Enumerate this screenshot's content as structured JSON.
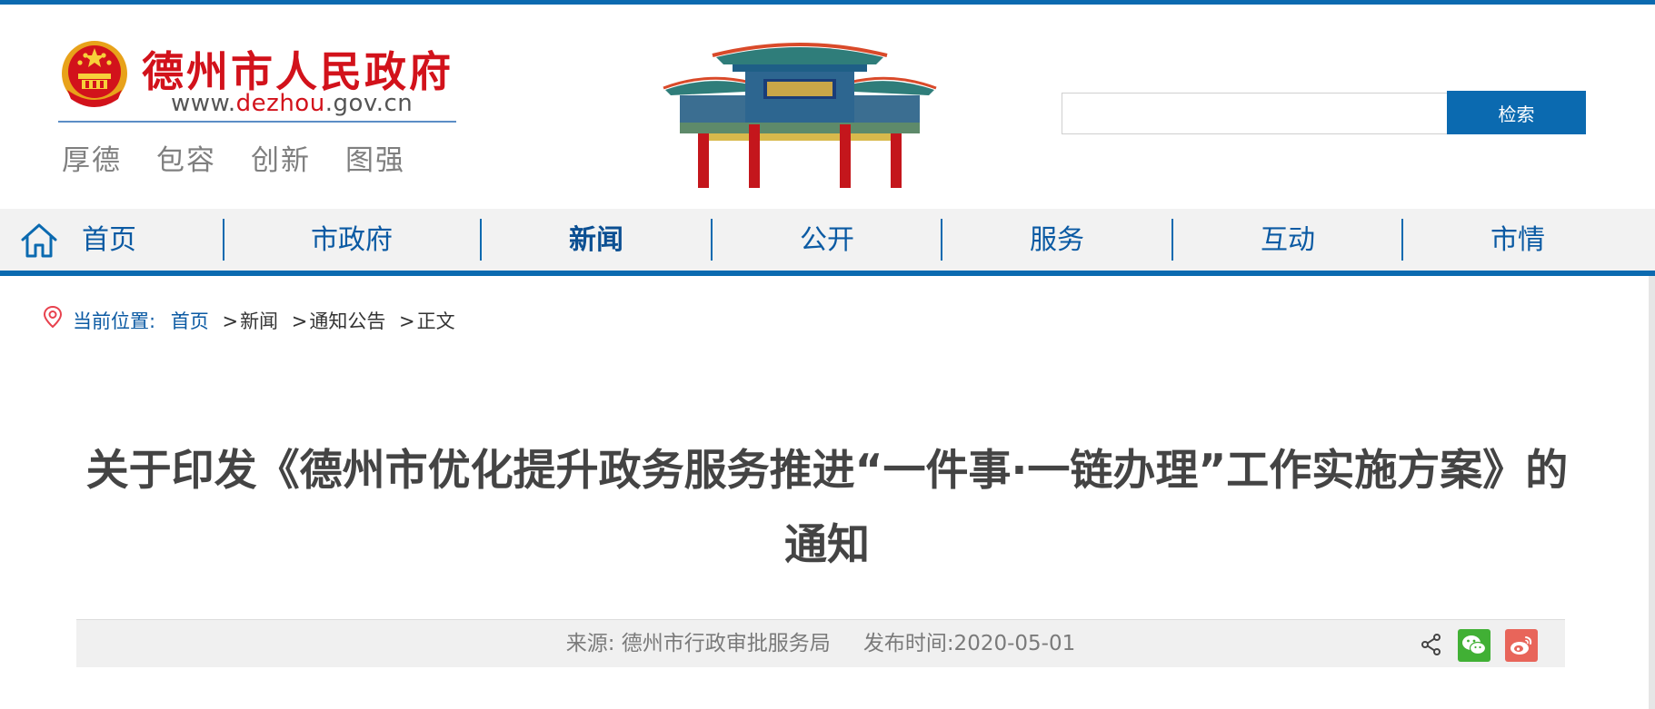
{
  "header": {
    "site_name": "德州市人民政府",
    "site_url_prefix": "www.",
    "site_url_highlight": "dezhou",
    "site_url_suffix": ".gov.cn",
    "slogan": [
      "厚德",
      "包容",
      "创新",
      "图强"
    ]
  },
  "search": {
    "value": "",
    "placeholder": "",
    "button_label": "检索"
  },
  "nav": {
    "items": [
      {
        "label": "首页"
      },
      {
        "label": "市政府"
      },
      {
        "label": "新闻"
      },
      {
        "label": "公开"
      },
      {
        "label": "服务"
      },
      {
        "label": "互动"
      },
      {
        "label": "市情"
      }
    ],
    "active_index": 2
  },
  "breadcrumb": {
    "label": "当前位置:",
    "items": [
      "首页",
      "新闻",
      "通知公告",
      "正文"
    ],
    "separator": ">"
  },
  "article": {
    "title": "关于印发《德州市优化提升政务服务推进“一件事·一链办理”工作实施方案》的通知",
    "source": "来源: 德州市行政审批服务局",
    "publish_time": "发布时间:2020-05-01"
  },
  "colors": {
    "brand_blue": "#0b6ab0",
    "brand_red": "#d2121b",
    "wechat_green": "#41b035",
    "weibo_red": "#e8655a"
  },
  "icons": {
    "home": "home-icon",
    "location": "location-pin-icon",
    "share": "share-icon",
    "wechat": "wechat-icon",
    "weibo": "weibo-icon"
  }
}
